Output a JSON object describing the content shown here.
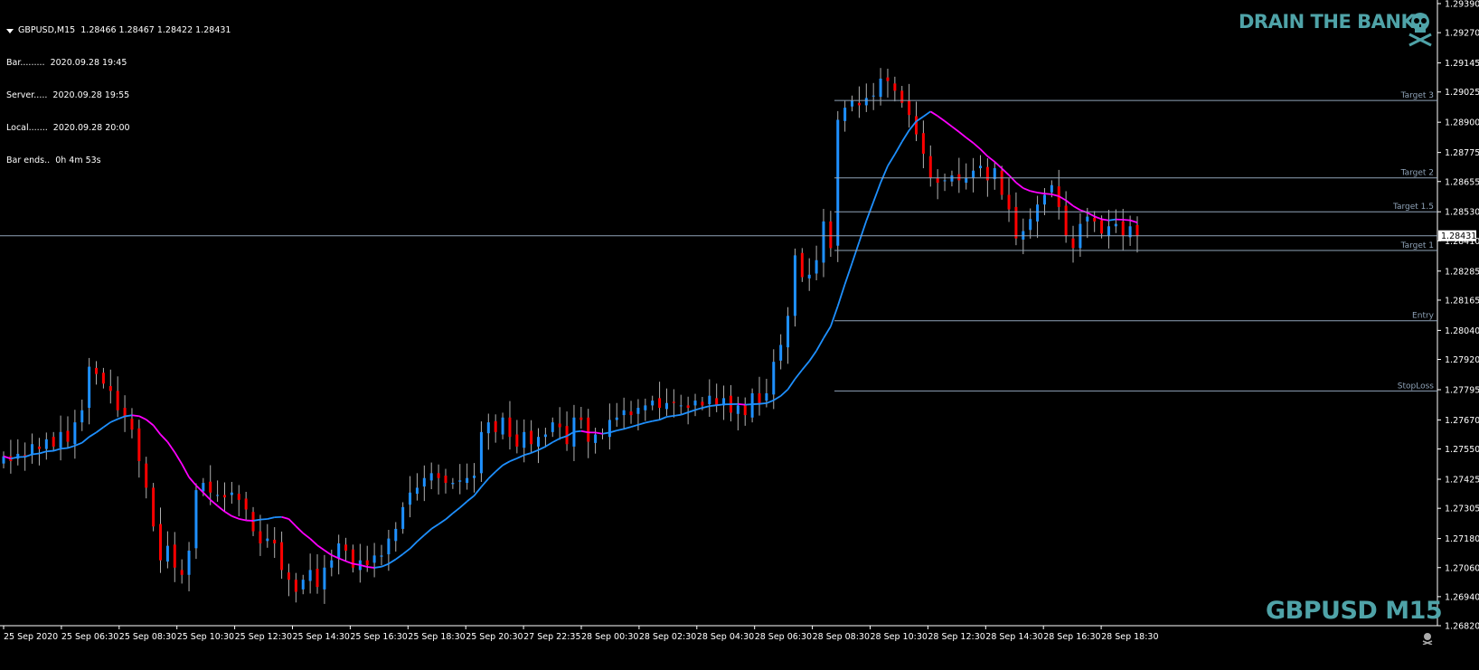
{
  "window": {
    "symbol_line": "GBPUSD,M15  1.28466 1.28467 1.28422 1.28431",
    "info_lines": [
      "Bar.........  2020.09.28 19:45",
      "Server.....  2020.09.28 19:55",
      "Local.......  2020.09.28 20:00",
      "Bar ends..  0h 4m 53s"
    ],
    "brand": "DRAIN THE BANKS",
    "watermark": "GBPUSD M15"
  },
  "colors": {
    "background": "#000000",
    "bull": "#1e90ff",
    "bear": "#ff0000",
    "wick": "#b0b0b0",
    "ma_up": "#1e90ff",
    "ma_down": "#ff00ff",
    "level_line": "#8fa3b8",
    "axis_text": "#ffffff",
    "brand": "#4fa3a8"
  },
  "chart_data": {
    "type": "candlestick",
    "symbol": "GBPUSD",
    "timeframe": "M15",
    "ylim": [
      1.2682,
      1.2939
    ],
    "y_ticks": [
      "1.29390",
      "1.29270",
      "1.29145",
      "1.29025",
      "1.28900",
      "1.28775",
      "1.28655",
      "1.28530",
      "1.28410",
      "1.28285",
      "1.28165",
      "1.28040",
      "1.27920",
      "1.27795",
      "1.27670",
      "1.27550",
      "1.27425",
      "1.27305",
      "1.27180",
      "1.27060",
      "1.26940",
      "1.26820"
    ],
    "x_ticks": [
      "25 Sep 2020",
      "25 Sep 06:30",
      "25 Sep 08:30",
      "25 Sep 10:30",
      "25 Sep 12:30",
      "25 Sep 14:30",
      "25 Sep 16:30",
      "25 Sep 18:30",
      "25 Sep 20:30",
      "27 Sep 22:35",
      "28 Sep 00:30",
      "28 Sep 02:30",
      "28 Sep 04:30",
      "28 Sep 06:30",
      "28 Sep 08:30",
      "28 Sep 10:30",
      "28 Sep 12:30",
      "28 Sep 14:30",
      "28 Sep 16:30",
      "28 Sep 18:30"
    ],
    "current_price": "1.28431",
    "current_price_value": 1.28431,
    "levels": [
      {
        "label": "Target 3",
        "value": 1.2899
      },
      {
        "label": "Target 2",
        "value": 1.2867
      },
      {
        "label": "Target 1.5",
        "value": 1.2853
      },
      {
        "label": "Target 1",
        "value": 1.2837
      },
      {
        "label": "Entry",
        "value": 1.2808
      },
      {
        "label": "StopLoss",
        "value": 1.2779
      }
    ],
    "candles_close": [
      1.2752,
      1.275,
      1.2753,
      1.2752,
      1.2757,
      1.2755,
      1.2759,
      1.2756,
      1.2762,
      1.2758,
      1.2766,
      1.2771,
      1.2789,
      1.2786,
      1.2782,
      1.2779,
      1.2771,
      1.2768,
      1.2763,
      1.275,
      1.2739,
      1.2723,
      1.2709,
      1.2715,
      1.2706,
      1.2703,
      1.2713,
      1.2738,
      1.2741,
      1.2737,
      1.2736,
      1.2735,
      1.2737,
      1.2734,
      1.273,
      1.2721,
      1.2716,
      1.2718,
      1.2716,
      1.2705,
      1.2701,
      1.2696,
      1.2701,
      1.2705,
      1.2698,
      1.2706,
      1.2709,
      1.2716,
      1.2713,
      1.2706,
      1.2709,
      1.2707,
      1.2711,
      1.2711,
      1.2718,
      1.2722,
      1.2731,
      1.2737,
      1.2739,
      1.2743,
      1.2745,
      1.2743,
      1.2741,
      1.2741,
      1.2742,
      1.2743,
      1.2744,
      1.2762,
      1.2766,
      1.2762,
      1.2768,
      1.276,
      1.2756,
      1.2762,
      1.2757,
      1.276,
      1.2761,
      1.2766,
      1.2764,
      1.2757,
      1.2768,
      1.2767,
      1.2758,
      1.2761,
      1.2761,
      1.2767,
      1.2768,
      1.2771,
      1.2769,
      1.2772,
      1.2773,
      1.2775,
      1.2772,
      1.2774,
      1.2774,
      1.2773,
      1.2772,
      1.2775,
      1.2773,
      1.2777,
      1.2773,
      1.2776,
      1.277,
      1.2773,
      1.2769,
      1.2778,
      1.2774,
      1.2778,
      1.2791,
      1.2798,
      1.281,
      1.2835,
      1.2826,
      1.2827,
      1.2833,
      1.2849,
      1.2838,
      1.2891,
      1.2896,
      1.2899,
      1.2897,
      1.29,
      1.2901,
      1.2908,
      1.2907,
      1.2903,
      1.2898,
      1.2893,
      1.2885,
      1.2877,
      1.2867,
      1.2865,
      1.2866,
      1.2868,
      1.2866,
      1.2867,
      1.287,
      1.2872,
      1.2866,
      1.2871,
      1.286,
      1.2854,
      1.2842,
      1.2845,
      1.285,
      1.2856,
      1.286,
      1.2864,
      1.2855,
      1.2843,
      1.2838,
      1.2848,
      1.2851,
      1.2849,
      1.2844,
      1.2847,
      1.2848,
      1.2843,
      1.2847,
      1.2843
    ]
  }
}
